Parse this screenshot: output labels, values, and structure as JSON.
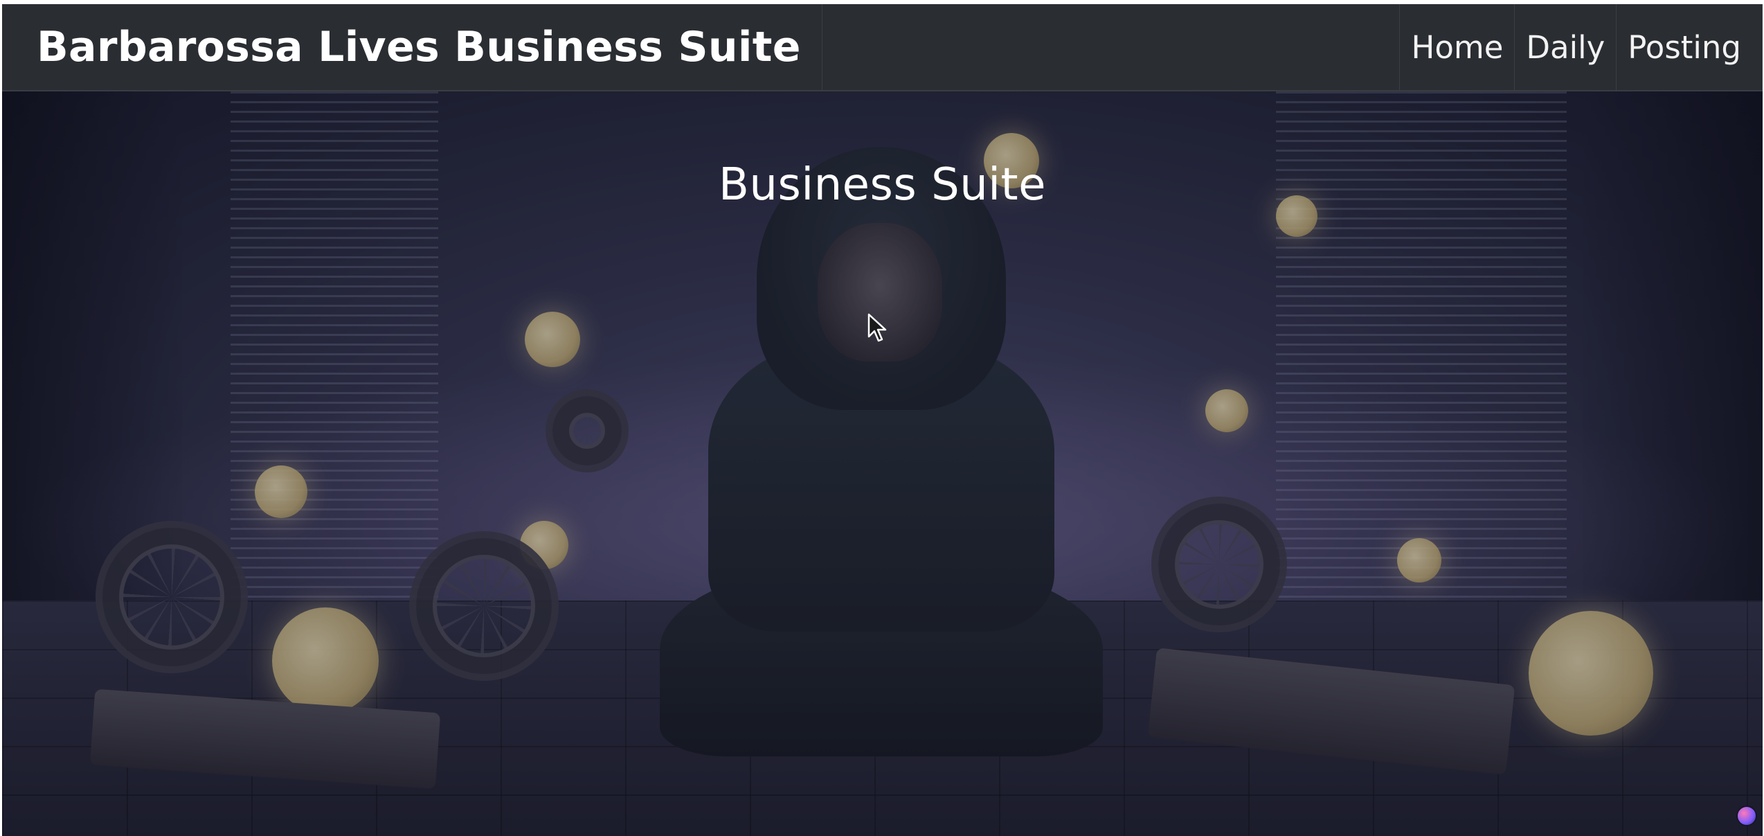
{
  "header": {
    "brand": "Barbarossa Lives Business Suite"
  },
  "nav": {
    "items": [
      {
        "label": "Home"
      },
      {
        "label": "Daily"
      },
      {
        "label": "Posting"
      }
    ]
  },
  "hero": {
    "title": "Business Suite"
  },
  "colors": {
    "navbar_bg": "#2a2d32",
    "text": "#ffffff"
  },
  "icons": {
    "cursor": "mouse-pointer-icon",
    "corner_badge": "app-badge-icon"
  }
}
